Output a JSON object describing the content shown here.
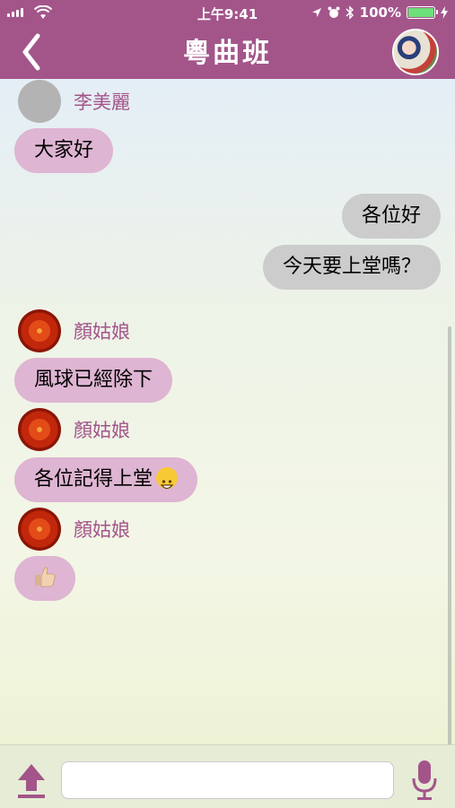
{
  "status_bar": {
    "time": "上午9:41",
    "battery": "100%"
  },
  "nav": {
    "title": "粵曲班",
    "back_icon": "back-chevron-icon",
    "avatar_icon": "group-avatar"
  },
  "messages": [
    {
      "sender": "李美麗",
      "text": "大家好",
      "direction": "in"
    },
    {
      "text": "各位好",
      "direction": "out"
    },
    {
      "text": "今天要上堂嗎？",
      "direction": "out"
    },
    {
      "sender": "顏姑娘",
      "text": "風球已經除下",
      "direction": "in"
    },
    {
      "sender": "顏姑娘",
      "text": "各位記得上堂",
      "emoji": "grinning-face-emoji",
      "direction": "in"
    },
    {
      "sender": "顏姑娘",
      "emoji": "thumbs-up-emoji",
      "direction": "in"
    }
  ],
  "composer": {
    "value": "",
    "placeholder": ""
  },
  "colors": {
    "brand": "#a3558a",
    "incoming_bubble": "#deb5d2",
    "outgoing_bubble": "#cccccc"
  }
}
